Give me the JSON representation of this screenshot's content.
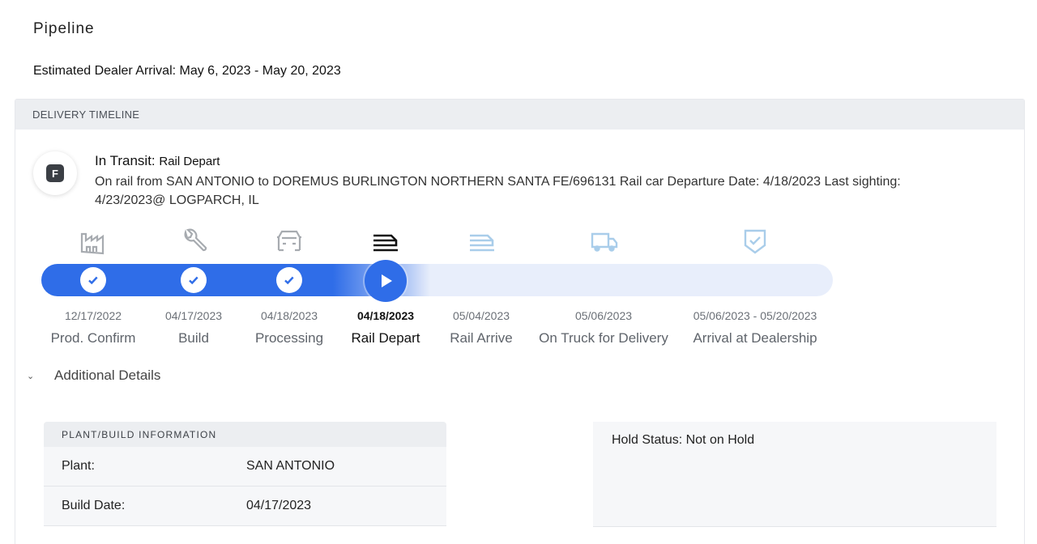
{
  "page": {
    "title": "Pipeline",
    "eta": "Estimated Dealer Arrival: May 6, 2023 - May 20, 2023"
  },
  "timeline": {
    "header": "DELIVERY TIMELINE",
    "badge_letter": "F",
    "status": "In Transit:",
    "status_detail": "Rail Depart",
    "description": "On rail from SAN ANTONIO to DOREMUS BURLINGTON NORTHERN SANTA FE/696131 Rail car Departure Date: 4/18/2023 Last sighting: 4/23/2023@ LOGPARCH, IL",
    "progress_current_step": 4,
    "steps": [
      {
        "date": "12/17/2022",
        "label": "Prod. Confirm",
        "icon": "factory-icon",
        "state": "complete"
      },
      {
        "date": "04/17/2023",
        "label": "Build",
        "icon": "wrench-icon",
        "state": "complete"
      },
      {
        "date": "04/18/2023",
        "label": "Processing",
        "icon": "car-front-icon",
        "state": "complete"
      },
      {
        "date": "04/18/2023",
        "label": "Rail Depart",
        "icon": "train-icon",
        "state": "current"
      },
      {
        "date": "05/04/2023",
        "label": "Rail Arrive",
        "icon": "train-icon",
        "state": "upcoming"
      },
      {
        "date": "05/06/2023",
        "label": "On Truck for Delivery",
        "icon": "truck-icon",
        "state": "upcoming"
      },
      {
        "date": "05/06/2023 - 05/20/2023",
        "label": "Arrival at Dealership",
        "icon": "shield-check-icon",
        "state": "upcoming"
      }
    ]
  },
  "details": {
    "toggle_label": "Additional Details",
    "plant_card": {
      "header": "PLANT/BUILD INFORMATION",
      "rows": [
        {
          "key": "Plant:",
          "value": "SAN ANTONIO"
        },
        {
          "key": "Build Date:",
          "value": "04/17/2023"
        }
      ]
    },
    "hold_status": "Hold Status: Not on Hold"
  },
  "colors": {
    "accent": "#2f6de8",
    "track_bg": "#e8eefb",
    "complete_icon": "#a7abb0",
    "upcoming_icon": "#a9cdea",
    "current_icon": "#111111"
  }
}
